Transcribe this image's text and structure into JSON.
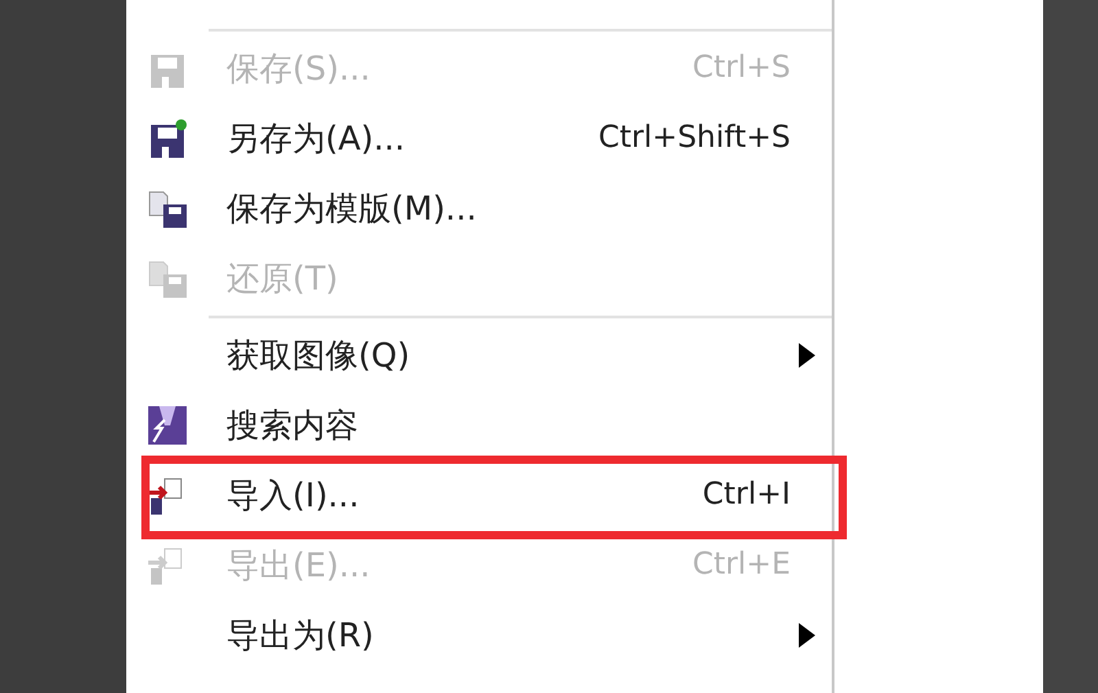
{
  "menu": {
    "items": [
      {
        "kind": "separator"
      },
      {
        "kind": "item",
        "label": "保存(S)...",
        "shortcut": "Ctrl+S",
        "disabled": true,
        "submenu": false,
        "highlighted": false
      },
      {
        "kind": "item",
        "label": "另存为(A)...",
        "shortcut": "Ctrl+Shift+S",
        "disabled": false,
        "submenu": false,
        "highlighted": false
      },
      {
        "kind": "item",
        "label": "保存为模版(M)...",
        "disabled": false,
        "submenu": false,
        "highlighted": false
      },
      {
        "kind": "item",
        "label": "还原(T)",
        "disabled": true,
        "submenu": false,
        "highlighted": false
      },
      {
        "kind": "separator"
      },
      {
        "kind": "item",
        "label": "获取图像(Q)",
        "disabled": false,
        "submenu": true,
        "highlighted": false
      },
      {
        "kind": "item",
        "label": "搜索内容",
        "disabled": false,
        "submenu": false,
        "highlighted": false
      },
      {
        "kind": "item",
        "label": "导入(I)...",
        "shortcut": "Ctrl+I",
        "disabled": false,
        "submenu": false,
        "highlighted": true
      },
      {
        "kind": "item",
        "label": "导出(E)...",
        "shortcut": "Ctrl+E",
        "disabled": true,
        "submenu": false,
        "highlighted": false
      },
      {
        "kind": "item",
        "label": "导出为(R)",
        "disabled": false,
        "submenu": true,
        "highlighted": false
      }
    ]
  }
}
